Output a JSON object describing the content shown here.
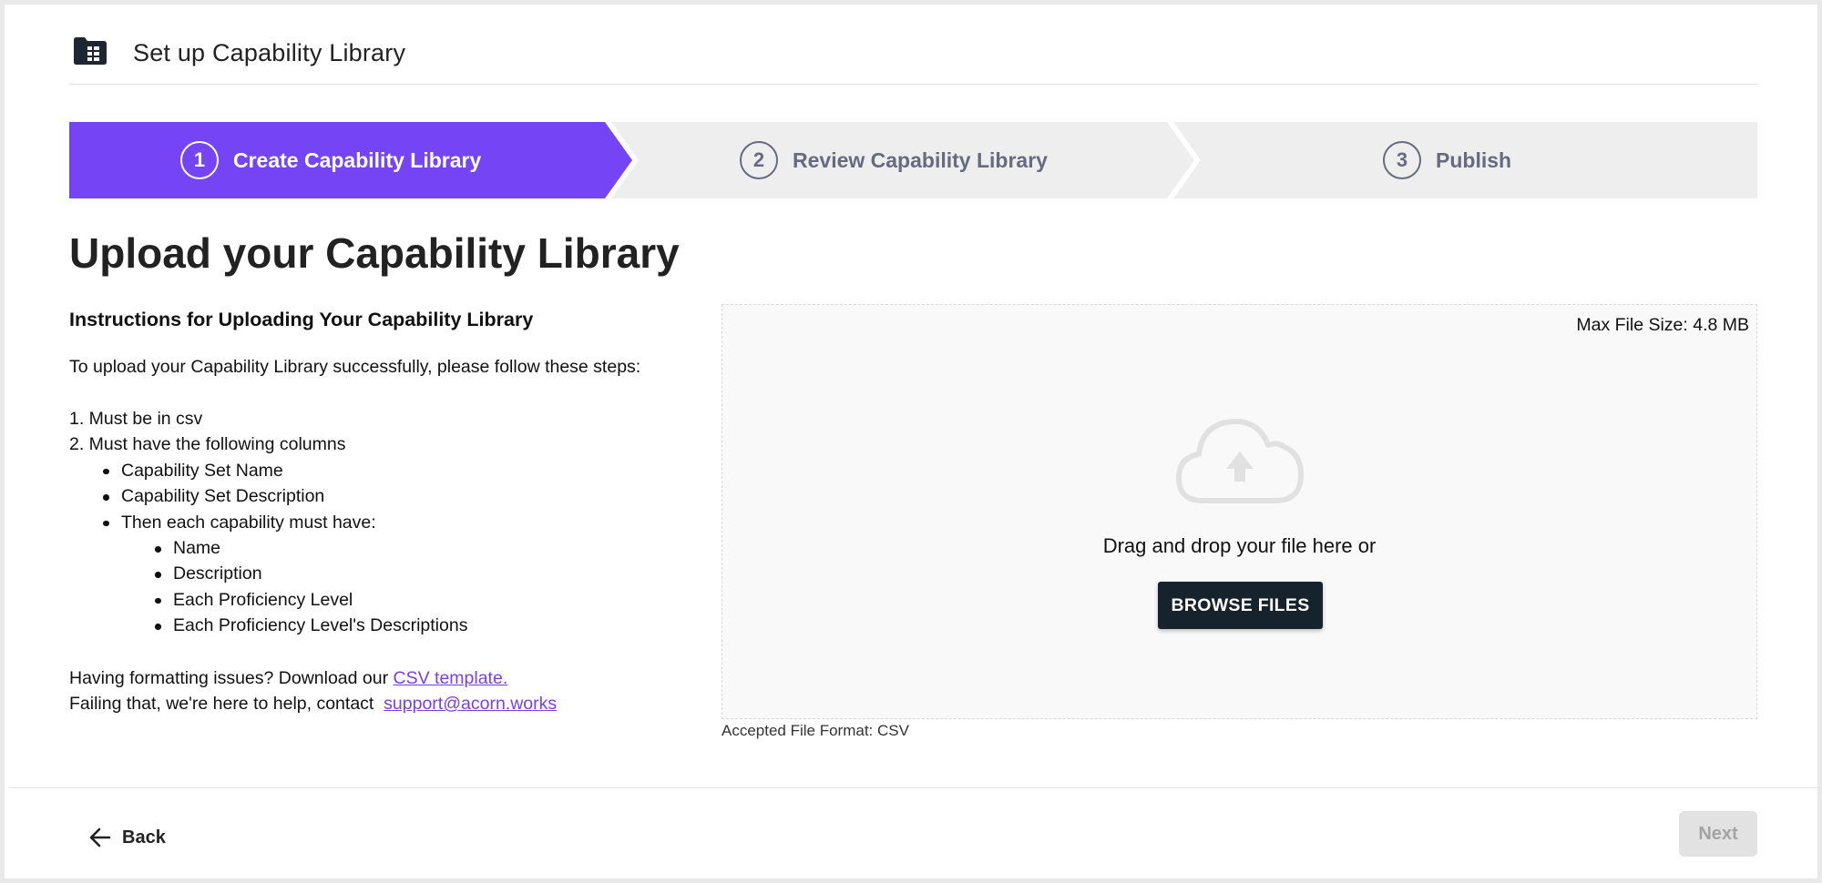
{
  "header": {
    "icon": "folder-table-icon",
    "title": "Set up Capability Library"
  },
  "stepper": {
    "active_color": "#7444f5",
    "inactive_color": "#eeeeef",
    "steps": [
      {
        "number": "1",
        "label": "Create Capability Library",
        "state": "active"
      },
      {
        "number": "2",
        "label": "Review Capability Library",
        "state": "inactive"
      },
      {
        "number": "3",
        "label": "Publish",
        "state": "inactive"
      }
    ]
  },
  "main": {
    "heading": "Upload your Capability Library",
    "instructions": {
      "title": "Instructions for Uploading Your Capability Library",
      "intro": "To upload your Capability Library successfully, please follow these steps:",
      "step1": "1. Must be in csv",
      "step2": "2. Must have the following columns",
      "columns": [
        "Capability Set Name",
        "Capability Set Description",
        "Then each capability must have:"
      ],
      "capability_fields": [
        "Name",
        "Description",
        "Each Proficiency Level",
        "Each Proficiency Level's Descriptions"
      ],
      "help_prefix": "Having formatting issues? Download our ",
      "help_link": "CSV template.",
      "contact_prefix": "Failing that, we're here to help, contact ",
      "contact_link": "support@acorn.works"
    },
    "dropzone": {
      "max_size": "Max File Size: 4.8 MB",
      "icon": "cloud-upload-icon",
      "prompt": "Drag and drop your file here or",
      "browse_label": "BROWSE FILES",
      "accepted": "Accepted File Format: CSV"
    }
  },
  "footer": {
    "back_label": "Back",
    "back_icon": "arrow-left-icon",
    "next_label": "Next"
  }
}
